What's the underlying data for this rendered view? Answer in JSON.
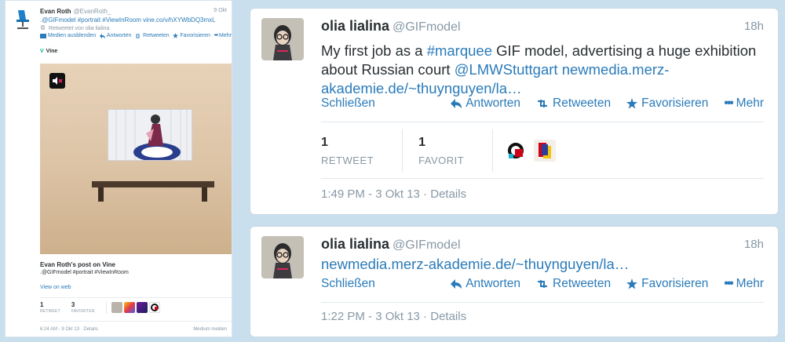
{
  "left": {
    "name": "Evan Roth",
    "handle": "@EvanRoth_",
    "time": "9 Okt",
    "text": ".@GIFmodel #portrait #ViewInRoom vine.co/v/hXYWbDQ3mxL",
    "retweeted_by": "Retweetet von olia lialina",
    "actions": {
      "media": "Medien ausblenden",
      "reply": "Antworten",
      "retweet": "Retweeten",
      "favorite": "Favorisieren",
      "more": "Mehr"
    },
    "source": "Vine",
    "card_title": "Evan Roth's post on Vine",
    "card_text": ".@GIFmodel #portrait #ViewInRoom",
    "view_web": "View on web",
    "retweets_count": "1",
    "retweets_label": "RETWEET",
    "favorites_count": "3",
    "favorites_label": "FAVORITEN",
    "footer": "6:24 AM - 9 Okt 13 · Details",
    "report": "Medium melden"
  },
  "card1": {
    "name": "olia lialina",
    "handle": "@GIFmodel",
    "time": "18h",
    "text_1": "My first job as a ",
    "hashtag": "#marquee",
    "text_2": " GIF model, advertising a huge exhibition about Russian court ",
    "mention": "@LMWStuttgart",
    "url": "newmedia.merz-akademie.de/~thuynguyen/la…",
    "close": "Schließen",
    "reply": "Antworten",
    "retweet": "Retweeten",
    "favorite": "Favorisieren",
    "more": "Mehr",
    "retweets_count": "1",
    "retweets_label": "RETWEET",
    "favorites_count": "1",
    "favorites_label": "FAVORIT",
    "timestamp": "1:49 PM - 3 Okt 13",
    "details": "Details"
  },
  "card2": {
    "name": "olia lialina",
    "handle": "@GIFmodel",
    "time": "18h",
    "url": "newmedia.merz-akademie.de/~thuynguyen/la…",
    "close": "Schließen",
    "reply": "Antworten",
    "retweet": "Retweeten",
    "favorite": "Favorisieren",
    "more": "Mehr",
    "timestamp": "1:22 PM - 3 Okt 13",
    "details": "Details"
  },
  "colors": {
    "link": "#2b7bb9",
    "muted": "#8899a6",
    "background": "#c9dfee"
  }
}
